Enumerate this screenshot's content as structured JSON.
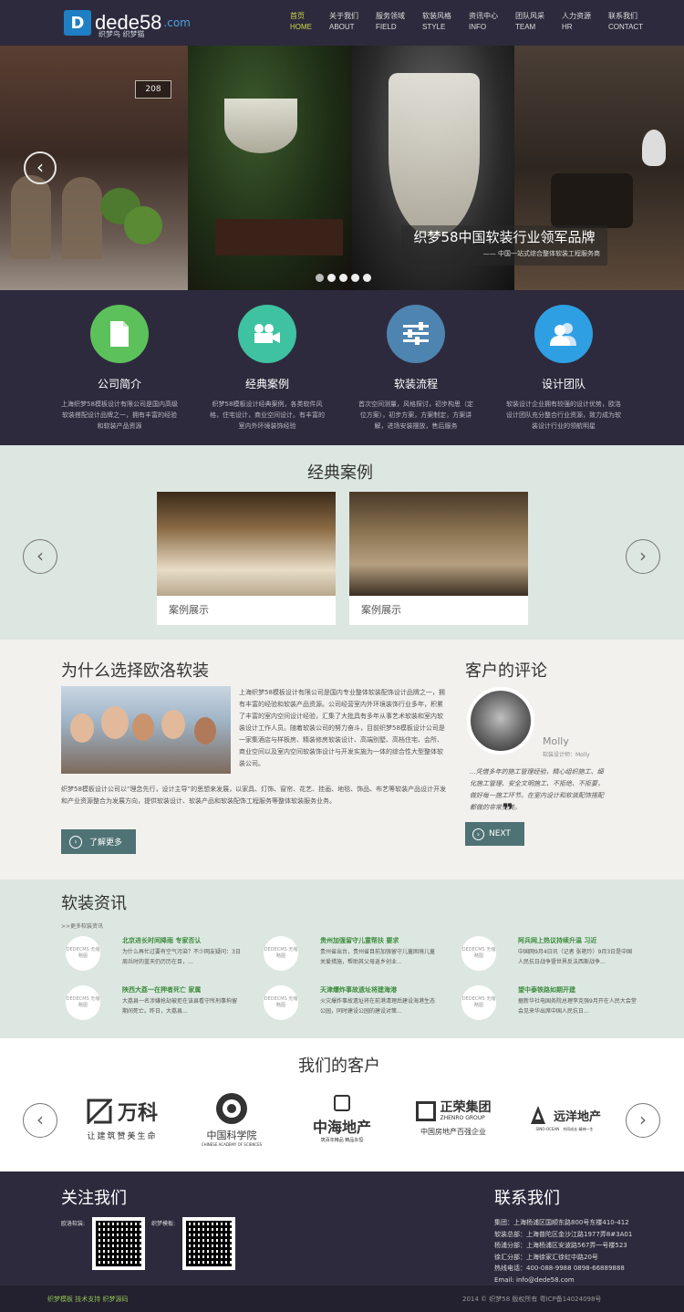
{
  "brand": {
    "logo_text": "dede58",
    "logo_com": ".com",
    "logo_sub": "织梦鸟 织梦猫"
  },
  "nav": [
    {
      "zh": "首页",
      "en": "HOME"
    },
    {
      "zh": "关于我们",
      "en": "ABOUT"
    },
    {
      "zh": "服务领域",
      "en": "FIELD"
    },
    {
      "zh": "软装风格",
      "en": "STYLE"
    },
    {
      "zh": "资讯中心",
      "en": "INFO"
    },
    {
      "zh": "团队风采",
      "en": "TEAM"
    },
    {
      "zh": "人力资源",
      "en": "HR"
    },
    {
      "zh": "联系我们",
      "en": "CONTACT"
    }
  ],
  "banner": {
    "door_number": "208",
    "title": "织梦58中国软装行业领军品牌",
    "subtitle": "—— 中国一站式综合整体软装工程服务商",
    "prev": "‹",
    "dots": 5,
    "active_dot": 0
  },
  "services": [
    {
      "title": "公司简介",
      "desc": "上海织梦58模板设计有限公司是国内高级软装搭配设计品牌之一，拥有丰富的经验和软装产品资源",
      "color": "#5cc15b",
      "icon": "document-icon"
    },
    {
      "title": "经典案例",
      "desc": "织梦58模板设计经典案例，各类软件风格，住宅设计，商业空间设计。有丰富的室内外环境装饰经验",
      "color": "#3ec2a1",
      "icon": "video-camera-icon"
    },
    {
      "title": "软装流程",
      "desc": "首次空间测量，风格探讨，初步构思（定位方案），初步方案，方案制定，方案讲解，进场安装摆放，售后服务",
      "color": "#4e84b0",
      "icon": "sliders-icon"
    },
    {
      "title": "设计团队",
      "desc": "软装设计企业拥有较强的设计优势，欧洛设计团队充分整合行业资源，致力成为软装设计行业的领航明星",
      "color": "#2f9fe3",
      "icon": "users-icon"
    }
  ],
  "cases": {
    "title": "经典案例",
    "prev": "‹",
    "next": "›",
    "items": [
      {
        "label": "案例展示"
      },
      {
        "label": "案例展示"
      }
    ]
  },
  "why": {
    "title": "为什么选择欧洛软装",
    "text1": "上海织梦58模板设计有限公司是国内专业整体软装配饰设计品牌之一，拥有丰富的经验和软装产品资源。公司经营室内外环境装饰行业多年，积累了丰富的室内空间设计经验，汇集了大批具有多年从事艺术软装和室内软装设计工作人员。随着软装公司的努力奋斗，目前织梦58模板设计公司是一家集酒店与样板房、精装修房软装设计、高端别墅、高档住宅、会所、商业空间以及室内空间软装饰设计与开发实施为一体的综合性大型整体软装公司。",
    "text2": "织梦58模板设计公司以“理念先行，设计主导”的思想来发展，以家具、灯饰、窗帘、花艺、挂画、地毯、饰品、布艺等软装产品设计开发和产业资源整合为发展方向，提供软装设计、软装产品和软装配饰工程服务等整体软装服务业务。",
    "button": "了解更多"
  },
  "comments": {
    "title": "客户的评论",
    "name": "Molly",
    "role": "软装设计师：Molly",
    "text": "...凭借多年的施工管理经验，精心组织施工、细化施工管理、安全文明施工、不拒绝、不拒要，做好每一施工环节。在室内设计和软装配饰搭配都做的非常完美。",
    "quote": "❞",
    "button": "NEXT"
  },
  "news": {
    "title": "软装资讯",
    "more": ">>更多软装资讯",
    "thumb": "DEDECMS 无缩略图",
    "items": [
      {
        "title": "北京进长时间降雨 专家否认",
        "desc": "为什么再忙过要有空气污染？不少网友疑问：3日周兵时的蓝天仍历历在目，..."
      },
      {
        "title": "贵州加强留守儿童帮扶 要求",
        "desc": "贵州省出台，贵州省目前加强留守儿童困境儿童关爱措施，帮助其父母返乡创业..."
      },
      {
        "title": "阿兵网上热议持续升温 习近",
        "desc": "中国网9月4日讯（记者 张艳玲）9月3日是中国人民抗日战争暨世界反法西斯战争..."
      },
      {
        "title": "陕西大荔一在押者死亡 家属",
        "desc": "大荔县一名涉嫌抢劫被拒在该县看守所刑事拘留期间死亡。昨日，大荔县..."
      },
      {
        "title": "天津爆炸事故遗址将建海港",
        "desc": "火灾爆炸事故遗址将在前港清理后建设海港生态公园，同时建设公园的建设对策..."
      },
      {
        "title": "望中泰铁路如期开建",
        "desc": "据新华社电国务院总理李克强9月开在人民大会堂会见来华出席中国人民抗日..."
      }
    ]
  },
  "clients": {
    "title": "我们的客户",
    "prev": "‹",
    "next": "›",
    "items": [
      {
        "name": "万科",
        "tagline": "让建筑赞美生命"
      },
      {
        "name": "中国科学院",
        "tagline": "CHINESE ACADEMY OF SCIENCES"
      },
      {
        "name": "中海地产",
        "tagline": "筑百年精品 精品永恒"
      },
      {
        "name": "正荣集团",
        "tagline": "中国房地产百强企业",
        "en": "ZHENRO GROUP"
      },
      {
        "name": "远洋地产",
        "tagline": "共同成长 精神一生",
        "en": "SINO-OCEAN"
      }
    ]
  },
  "footer": {
    "follow_title": "关注我们",
    "qr1_label": "欧洛软装:",
    "qr2_label": "织梦模板:",
    "contact_title": "联系我们",
    "contacts": [
      "集团：上海杨浦区国顺东路800号东楼410-412",
      "软装总部：上海普陀区金沙江路1977弄8#3A01",
      "杨浦分部：上海杨浦区安波路567弄一号楼523",
      "徐汇分部：上海徐家汇徐虹中路20号",
      "热线电话：400-088-9988 0898-66889888",
      "Email: info@dede58.com"
    ],
    "bottom_left": "织梦模板 技术支持 织梦源码",
    "bottom_right": "2014 © 织梦58 版权所有 粤ICP备14024098号"
  }
}
